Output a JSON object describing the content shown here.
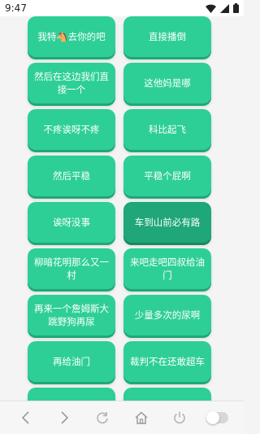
{
  "status_bar": {
    "time": "9:47",
    "icons": [
      "wifi-icon",
      "signal-icon",
      "battery-icon"
    ]
  },
  "grid": {
    "buttons": [
      {
        "label": "我特🐴去你的吧"
      },
      {
        "label": "直接播倒"
      },
      {
        "label": "然后在这边我们直接一个"
      },
      {
        "label": "这他妈是哪"
      },
      {
        "label": "不疼诶呀不疼"
      },
      {
        "label": "科比起飞"
      },
      {
        "label": "然后平稳"
      },
      {
        "label": "平稳个屁啊"
      },
      {
        "label": "诶呀没事"
      },
      {
        "label": "车到山前必有路",
        "selected": true
      },
      {
        "label": "柳暗花明那么又一村"
      },
      {
        "label": "来吧走吧四叔给油门"
      },
      {
        "label": "再来一个詹姆斯大跳野狗再尿"
      },
      {
        "label": "少量多次的尿啊"
      },
      {
        "label": "再给油门"
      },
      {
        "label": "裁判不在还敢超车"
      },
      {
        "label": ""
      },
      {
        "label": ""
      }
    ]
  },
  "bottom_nav": {
    "items": [
      "back-icon",
      "forward-icon",
      "refresh-icon",
      "home-icon",
      "power-icon",
      "toggle"
    ]
  },
  "colors": {
    "button": "#2ecf97",
    "button_shadow": "#1da977",
    "button_selected": "#1fa679"
  }
}
